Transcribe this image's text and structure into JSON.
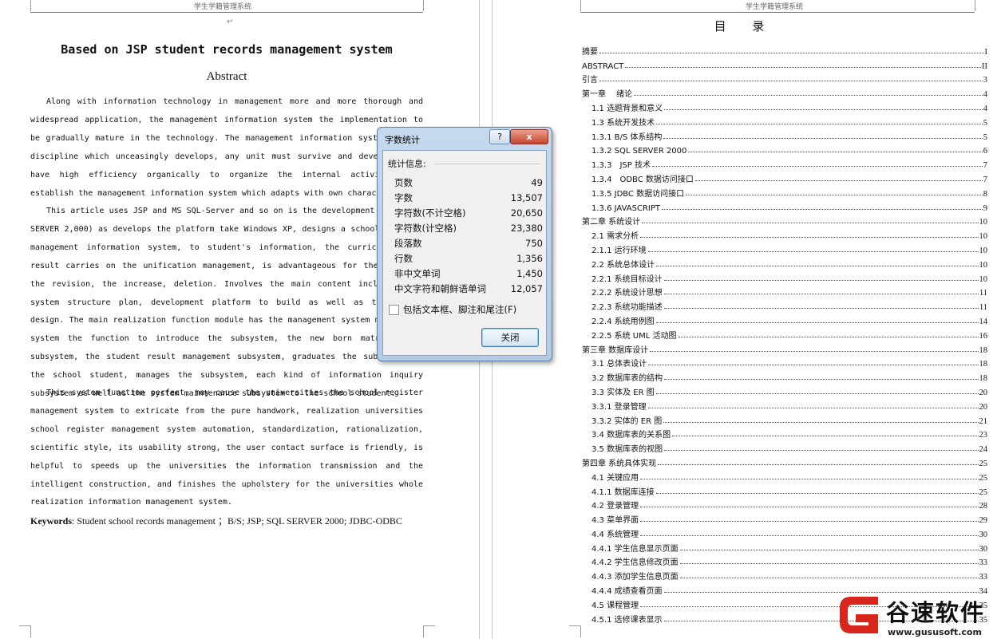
{
  "left_page": {
    "header": "学生学籍管理系统",
    "title": "Based on JSP student records management system",
    "abstract_heading": "Abstract",
    "paragraphs": [
      "Along with information technology in management more and more thorough and widespread application, the management information system the implementation to be gradually mature in the technology. The management information system is one discipline which unceasingly develops, any unit must survive and develop, must have high efficiency organically to organize the internal activity, must establish the management information system which adapts with own characteristic.",
      "This article uses JSP and MS SQL-Server and so on is the development kit, (SQL SERVER 2,000) as develops the platform take Windows XP, designs a school register management information system, to student's information, the curriculum, the result carries on the unification management, is advantageous for the inquiry, the revision, the increase, deletion. Involves the main content includes: The system structure plan, development platform to build as well as the system design. The main realization function module has the management system management system the function to introduce the subsystem, the new born matriculation subsystem, the student result management subsystem, graduates the subsystem in the school student, manages the subsystem, each kind of information inquiry subsystem as well as the system maintenance subsystem to the school student.",
      "This system function perfect, may cause the universities the school register management system to extricate from the pure handwork, realization universities school register management system automation, standardization, rationalization, scientific style, its usability strong, the user contact surface is friendly, is helpful to speeds up the universities the information transmission and the intelligent construction, and finishes the upholstery for the universities whole realization information management system."
    ],
    "keywords_label": "Keywords",
    "keywords_text": ": Student school records management ；B/S; JSP; SQL SERVER 2000; JDBC-ODBC"
  },
  "right_page": {
    "header": "学生学籍管理系统",
    "toc_title": "目 录",
    "toc": [
      {
        "text": "摘要",
        "page": "I",
        "level": 1
      },
      {
        "text": "ABSTRACT",
        "page": "II",
        "level": 1
      },
      {
        "text": "引言",
        "page": "3",
        "level": 1
      },
      {
        "text": "第一章　 绪论",
        "page": "4",
        "level": 1
      },
      {
        "text": "1.1 选题背景和意义",
        "page": "4",
        "level": 2
      },
      {
        "text": "1.3 系统开发技术",
        "page": "5",
        "level": 2
      },
      {
        "text": "1.3.1 B/S 体系结构",
        "page": "5",
        "level": 2
      },
      {
        "text": "1.3.2 SQL SERVER 2000",
        "page": "6",
        "level": 2
      },
      {
        "text": "1.3.3　JSP 技术",
        "page": "7",
        "level": 2
      },
      {
        "text": "1.3.4　ODBC 数据访问接口",
        "page": "7",
        "level": 2
      },
      {
        "text": "1.3.5 JDBC 数据访问接口",
        "page": "8",
        "level": 2
      },
      {
        "text": "1.3.6 JAVASCRIPT",
        "page": "9",
        "level": 2
      },
      {
        "text": "第二章 系统设计",
        "page": "10",
        "level": 1
      },
      {
        "text": "2.1 需求分析",
        "page": "10",
        "level": 2
      },
      {
        "text": "2.1.1 运行环境",
        "page": "10",
        "level": 2
      },
      {
        "text": "2.2 系统总体设计",
        "page": "10",
        "level": 2
      },
      {
        "text": "2.2.1 系统目标设计",
        "page": "10",
        "level": 2
      },
      {
        "text": "2.2.2 系统设计思想",
        "page": "11",
        "level": 2
      },
      {
        "text": "2.2.3 系统功能描述",
        "page": "11",
        "level": 2
      },
      {
        "text": "2.2.4 系统用例图",
        "page": "14",
        "level": 2
      },
      {
        "text": "2.2.5 系统 UML 活动图",
        "page": "16",
        "level": 2
      },
      {
        "text": "第三章 数据库设计",
        "page": "18",
        "level": 1
      },
      {
        "text": "3.1 总体表设计",
        "page": "18",
        "level": 2
      },
      {
        "text": "3.2 数据库表的结构",
        "page": "18",
        "level": 2
      },
      {
        "text": "3.3 实体及 ER 图",
        "page": "20",
        "level": 2
      },
      {
        "text": "3.3.1 登录管理",
        "page": "20",
        "level": 2
      },
      {
        "text": "3.3.2 实体的 ER 图",
        "page": "21",
        "level": 2
      },
      {
        "text": "3.4 数据库表的关系图",
        "page": "23",
        "level": 2
      },
      {
        "text": "3.5 数据库表的视图",
        "page": "24",
        "level": 2
      },
      {
        "text": "第四章 系统具体实现",
        "page": "25",
        "level": 1
      },
      {
        "text": "4.1 关键应用",
        "page": "25",
        "level": 2
      },
      {
        "text": "4.1.1 数据库连接",
        "page": "25",
        "level": 2
      },
      {
        "text": "4.2 登录管理",
        "page": "28",
        "level": 2
      },
      {
        "text": "4.3 菜单界面",
        "page": "29",
        "level": 2
      },
      {
        "text": "4.4 系统管理",
        "page": "30",
        "level": 2
      },
      {
        "text": "4.4.1 学生信息显示页面",
        "page": "30",
        "level": 2
      },
      {
        "text": "4.4.2 学生信息修改页面",
        "page": "33",
        "level": 2
      },
      {
        "text": "4.4.3 添加学生信息页面",
        "page": "33",
        "level": 2
      },
      {
        "text": "4.4.4 成绩查看页面",
        "page": "34",
        "level": 2
      },
      {
        "text": "4.5 课程管理",
        "page": "35",
        "level": 2
      },
      {
        "text": "4.5.1 选修课表显示",
        "page": "35",
        "level": 2
      }
    ]
  },
  "dialog": {
    "title": "字数统计",
    "help_glyph": "?",
    "close_glyph": "x",
    "group_label": "统计信息:",
    "stats": [
      {
        "label": "页数",
        "value": "49"
      },
      {
        "label": "字数",
        "value": "13,507"
      },
      {
        "label": "字符数(不计空格)",
        "value": "20,650"
      },
      {
        "label": "字符数(计空格)",
        "value": "23,380"
      },
      {
        "label": "段落数",
        "value": "750"
      },
      {
        "label": "行数",
        "value": "1,356"
      },
      {
        "label": "非中文单词",
        "value": "1,450"
      },
      {
        "label": "中文字符和朝鲜语单词",
        "value": "12,057"
      }
    ],
    "checkbox_label": "包括文本框、脚注和尾注(F)",
    "checkbox_checked": false,
    "close_button": "关闭"
  },
  "watermark": {
    "brand": "谷速软件",
    "url": "www.gususoft.com",
    "color": "#d9261c"
  },
  "colors": {
    "dialog_frame": "#b4cbe4",
    "close_red": "#c8452f"
  }
}
